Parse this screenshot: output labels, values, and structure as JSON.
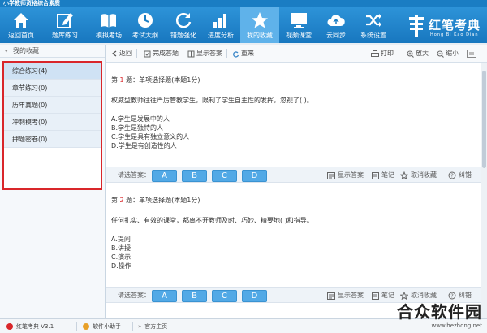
{
  "window": {
    "title": "小学教师资格综合素质"
  },
  "toolbar": {
    "items": [
      {
        "label": "返回首页",
        "icon": "home-icon"
      },
      {
        "label": "题库练习",
        "icon": "edit-icon"
      },
      {
        "label": "模拟考场",
        "icon": "book-icon"
      },
      {
        "label": "考试大纲",
        "icon": "clock-icon"
      },
      {
        "label": "错题强化",
        "icon": "refresh-icon"
      },
      {
        "label": "进度分析",
        "icon": "bar-chart-icon"
      },
      {
        "label": "我的收藏",
        "icon": "star-icon",
        "active": true
      },
      {
        "label": "视频课堂",
        "icon": "monitor-icon"
      },
      {
        "label": "云同步",
        "icon": "cloud-icon"
      },
      {
        "label": "系统设置",
        "icon": "shuffle-icon"
      }
    ],
    "brand": {
      "name": "红笔考典",
      "pinyin": "Hong Bi Kao Dian"
    }
  },
  "sidebar": {
    "header": "我的收藏",
    "items": [
      {
        "label": "综合练习(4)",
        "selected": true
      },
      {
        "label": "章节练习(0)"
      },
      {
        "label": "历年真题(0)"
      },
      {
        "label": "冲刺模考(0)"
      },
      {
        "label": "押题密卷(0)"
      }
    ]
  },
  "topnav": {
    "back": "返回",
    "finish": "完成答题",
    "show_answer": "显示答案",
    "redo": "重来",
    "print": "打印",
    "zoom_in": "放大",
    "zoom_out": "缩小"
  },
  "questions": [
    {
      "prefix": "第 ",
      "number": "1",
      "suffix": " 题：单项选择题(本题1分)",
      "stem": "权威型教师往往严厉管教学生，限制了学生自主性的发挥，忽视了( )。",
      "options": [
        "A.学生是发展中的人",
        "B.学生是独特的人",
        "C.学生是具有独立意义的人",
        "D.学生是有创造性的人"
      ]
    },
    {
      "prefix": "第 ",
      "number": "2",
      "suffix": " 题：单项选择题(本题1分)",
      "stem": "任何扎实、有效的课堂，都离不开教师及时、巧妙、精要地( )和指导。",
      "options": [
        "A.提问",
        "B.讲授",
        "C.演示",
        "D.操作"
      ]
    }
  ],
  "answer_bar": {
    "label": "请选答案：",
    "choices": [
      "A",
      "B",
      "C",
      "D"
    ],
    "show_answer": "显示答案",
    "notes": "笔记",
    "unfavorite": "取消收藏",
    "report": "纠错"
  },
  "statusbar": {
    "version": "红笔考典 V3.1",
    "assistant": "软件小助手",
    "homepage": "官方主页"
  },
  "watermark": {
    "text": "合众软件园",
    "url": "www.hezhong.net"
  },
  "colors": {
    "toolbar": "#1a7dc3",
    "accent_red": "#d9262a",
    "option_button": "#52a9e6"
  }
}
